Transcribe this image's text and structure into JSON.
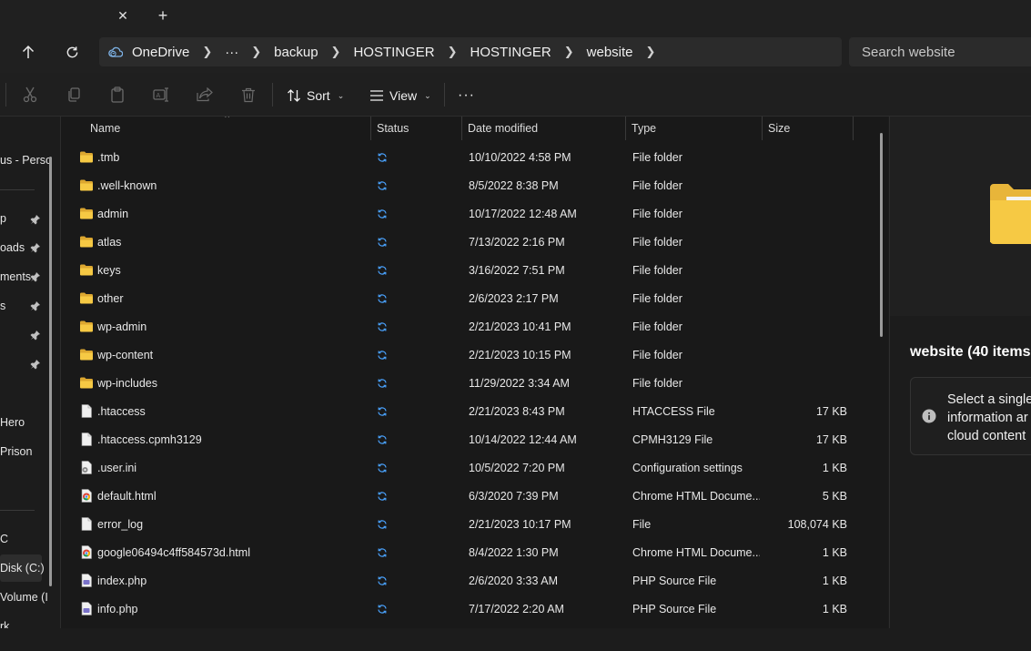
{
  "tabbar": {
    "close_glyph": "✕",
    "new_tab_glyph": "+"
  },
  "navigation": {
    "up_icon": "arrow-up-icon",
    "refresh_icon": "refresh-icon"
  },
  "address": {
    "root": "OneDrive",
    "overflow": "···",
    "crumbs": [
      "backup",
      "HOSTINGER",
      "HOSTINGER",
      "website"
    ]
  },
  "search": {
    "placeholder": "Search website"
  },
  "toolbar": {
    "sort_label": "Sort",
    "view_label": "View",
    "more_label": "···"
  },
  "sidebar": {
    "items": [
      {
        "label": "us - Perso",
        "pinned": false
      },
      {
        "label": "p",
        "pinned": true
      },
      {
        "label": "oads",
        "pinned": true
      },
      {
        "label": "ments",
        "pinned": true
      },
      {
        "label": "s",
        "pinned": true
      },
      {
        "label": "",
        "pinned": true
      },
      {
        "label": "",
        "pinned": true
      },
      {
        "label": "Hero",
        "pinned": false
      },
      {
        "label": "Prison",
        "pinned": false
      },
      {
        "label": "C",
        "pinned": false
      },
      {
        "label": "Disk (C:)",
        "pinned": false
      },
      {
        "label": "Volume (I",
        "pinned": false
      },
      {
        "label": "rk",
        "pinned": false
      }
    ]
  },
  "columns": {
    "name": "Name",
    "status": "Status",
    "date": "Date modified",
    "type": "Type",
    "size": "Size"
  },
  "files": [
    {
      "name": ".tmb",
      "date": "10/10/2022 4:58 PM",
      "type": "File folder",
      "size": "",
      "icon": "folder"
    },
    {
      "name": ".well-known",
      "date": "8/5/2022 8:38 PM",
      "type": "File folder",
      "size": "",
      "icon": "folder"
    },
    {
      "name": "admin",
      "date": "10/17/2022 12:48 AM",
      "type": "File folder",
      "size": "",
      "icon": "folder"
    },
    {
      "name": "atlas",
      "date": "7/13/2022 2:16 PM",
      "type": "File folder",
      "size": "",
      "icon": "folder"
    },
    {
      "name": "keys",
      "date": "3/16/2022 7:51 PM",
      "type": "File folder",
      "size": "",
      "icon": "folder"
    },
    {
      "name": "other",
      "date": "2/6/2023 2:17 PM",
      "type": "File folder",
      "size": "",
      "icon": "folder"
    },
    {
      "name": "wp-admin",
      "date": "2/21/2023 10:41 PM",
      "type": "File folder",
      "size": "",
      "icon": "folder"
    },
    {
      "name": "wp-content",
      "date": "2/21/2023 10:15 PM",
      "type": "File folder",
      "size": "",
      "icon": "folder"
    },
    {
      "name": "wp-includes",
      "date": "11/29/2022 3:34 AM",
      "type": "File folder",
      "size": "",
      "icon": "folder"
    },
    {
      "name": ".htaccess",
      "date": "2/21/2023 8:43 PM",
      "type": "HTACCESS File",
      "size": "17 KB",
      "icon": "file"
    },
    {
      "name": ".htaccess.cpmh3129",
      "date": "10/14/2022 12:44 AM",
      "type": "CPMH3129 File",
      "size": "17 KB",
      "icon": "file"
    },
    {
      "name": ".user.ini",
      "date": "10/5/2022 7:20 PM",
      "type": "Configuration settings",
      "size": "1 KB",
      "icon": "settings-file"
    },
    {
      "name": "default.html",
      "date": "6/3/2020 7:39 PM",
      "type": "Chrome HTML Docume...",
      "size": "5 KB",
      "icon": "chrome-file"
    },
    {
      "name": "error_log",
      "date": "2/21/2023 10:17 PM",
      "type": "File",
      "size": "108,074 KB",
      "icon": "file"
    },
    {
      "name": "google06494c4ff584573d.html",
      "date": "8/4/2022 1:30 PM",
      "type": "Chrome HTML Docume...",
      "size": "1 KB",
      "icon": "chrome-file"
    },
    {
      "name": "index.php",
      "date": "2/6/2020 3:33 AM",
      "type": "PHP Source File",
      "size": "1 KB",
      "icon": "php-file"
    },
    {
      "name": "info.php",
      "date": "7/17/2022 2:20 AM",
      "type": "PHP Source File",
      "size": "1 KB",
      "icon": "php-file"
    }
  ],
  "details": {
    "title": "website (40 items",
    "info_lines": [
      "Select a single",
      "information ar",
      "cloud content"
    ]
  },
  "colors": {
    "folder": "#f6c944",
    "sync": "#4aa3ff",
    "background": "#191919"
  }
}
